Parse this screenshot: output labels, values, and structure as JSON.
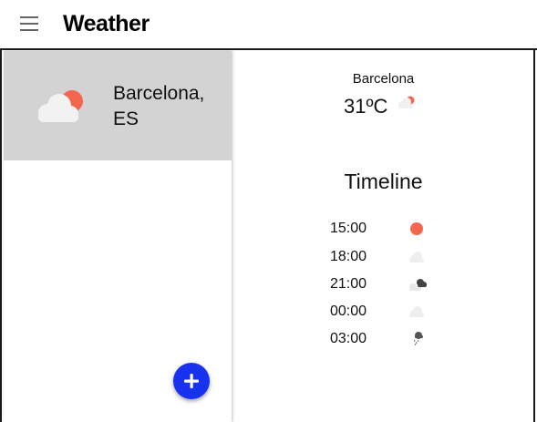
{
  "app": {
    "title": "Weather"
  },
  "sidebar": {
    "cities": [
      {
        "name": "Barcelona, ES",
        "icon": "cloud-sun-icon"
      }
    ],
    "add_button_icon": "plus-icon"
  },
  "detail": {
    "city": "Barcelona",
    "temperature": "31ºC",
    "current_icon": "cloud-sun-icon",
    "timeline_title": "Timeline",
    "timeline": [
      {
        "time": "15:00",
        "icon": "sun-icon"
      },
      {
        "time": "18:00",
        "icon": "cloud-icon"
      },
      {
        "time": "21:00",
        "icon": "cloudy-icon"
      },
      {
        "time": "00:00",
        "icon": "cloud-icon"
      },
      {
        "time": "03:00",
        "icon": "rain-icon"
      }
    ]
  },
  "colors": {
    "accent_fab": "#1932f0",
    "sun": "#f4674f",
    "selected_card": "#d3d3d3"
  }
}
